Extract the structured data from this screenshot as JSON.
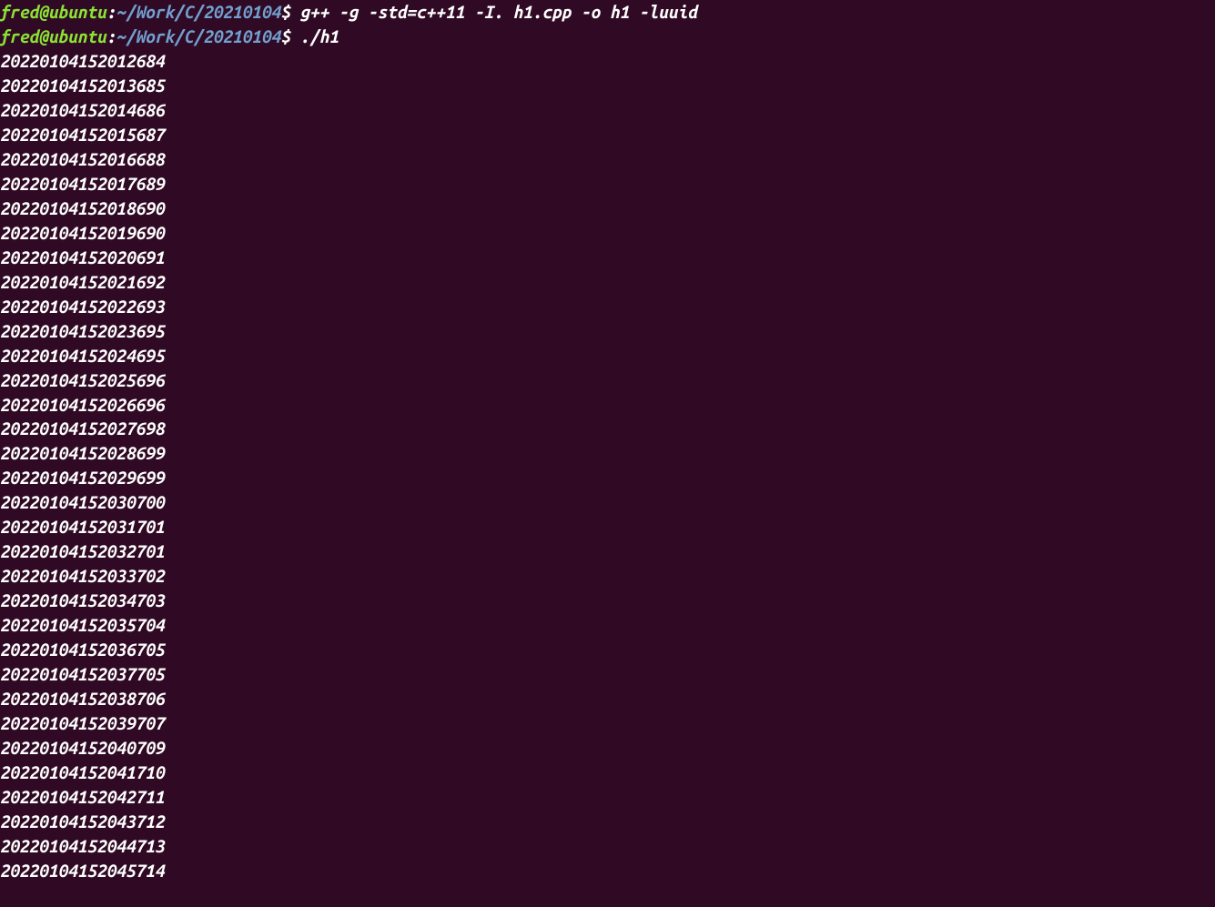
{
  "terminal": {
    "lines": [
      {
        "type": "prompt",
        "userHost": "fred@ubuntu",
        "colon": ":",
        "path": "~/Work/C/20210104",
        "dollar": "$ ",
        "command": "g++ -g -std=c++11 -I. h1.cpp -o h1 -luuid"
      },
      {
        "type": "prompt",
        "userHost": "fred@ubuntu",
        "colon": ":",
        "path": "~/Work/C/20210104",
        "dollar": "$ ",
        "command": "./h1"
      },
      {
        "type": "output",
        "text": "20220104152012684"
      },
      {
        "type": "output",
        "text": "20220104152013685"
      },
      {
        "type": "output",
        "text": "20220104152014686"
      },
      {
        "type": "output",
        "text": "20220104152015687"
      },
      {
        "type": "output",
        "text": "20220104152016688"
      },
      {
        "type": "output",
        "text": "20220104152017689"
      },
      {
        "type": "output",
        "text": "20220104152018690"
      },
      {
        "type": "output",
        "text": "20220104152019690"
      },
      {
        "type": "output",
        "text": "20220104152020691"
      },
      {
        "type": "output",
        "text": "20220104152021692"
      },
      {
        "type": "output",
        "text": "20220104152022693"
      },
      {
        "type": "output",
        "text": "20220104152023695"
      },
      {
        "type": "output",
        "text": "20220104152024695"
      },
      {
        "type": "output",
        "text": "20220104152025696"
      },
      {
        "type": "output",
        "text": "20220104152026696"
      },
      {
        "type": "output",
        "text": "20220104152027698"
      },
      {
        "type": "output",
        "text": "20220104152028699"
      },
      {
        "type": "output",
        "text": "20220104152029699"
      },
      {
        "type": "output",
        "text": "20220104152030700"
      },
      {
        "type": "output",
        "text": "20220104152031701"
      },
      {
        "type": "output",
        "text": "20220104152032701"
      },
      {
        "type": "output",
        "text": "20220104152033702"
      },
      {
        "type": "output",
        "text": "20220104152034703"
      },
      {
        "type": "output",
        "text": "20220104152035704"
      },
      {
        "type": "output",
        "text": "20220104152036705"
      },
      {
        "type": "output",
        "text": "20220104152037705"
      },
      {
        "type": "output",
        "text": "20220104152038706"
      },
      {
        "type": "output",
        "text": "20220104152039707"
      },
      {
        "type": "output",
        "text": "20220104152040709"
      },
      {
        "type": "output",
        "text": "20220104152041710"
      },
      {
        "type": "output",
        "text": "20220104152042711"
      },
      {
        "type": "output",
        "text": "20220104152043712"
      },
      {
        "type": "output",
        "text": "20220104152044713"
      },
      {
        "type": "output",
        "text": "20220104152045714"
      }
    ]
  }
}
